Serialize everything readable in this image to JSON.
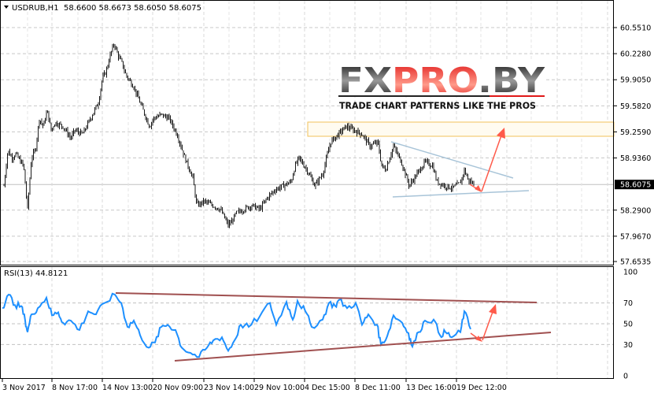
{
  "header": {
    "symbol": "USDRUB,H1",
    "ohlc": "58.6600 58.6673 58.6050 58.6075"
  },
  "rsi_header": "RSI(13) 44.8121",
  "logo": {
    "main": "FXPRO.BY",
    "tagline": "TRADE CHART PATTERNS LIKE THE PROS"
  },
  "colors": {
    "bars": "#000000",
    "rsi": "#1e90ff",
    "trend_rsi": "#a05050",
    "trend_main": "#a8c4d8",
    "arrow": "#ff5a4a",
    "zone": "#f2c25a"
  },
  "chart_data": [
    {
      "type": "ohlc",
      "title": "USDRUB,H1",
      "ylim": [
        57.6535,
        60.551
      ],
      "yticks": [
        "60.5510",
        "60.2280",
        "59.9050",
        "59.5820",
        "59.2590",
        "58.9360",
        "58.2900",
        "57.9670",
        "57.6535"
      ],
      "current_price": "58.6075",
      "xticks": [
        "3 Nov 2017",
        "8 Nov 17:00",
        "14 Nov 13:00",
        "20 Nov 09:00",
        "23 Nov 14:00",
        "29 Nov 10:00",
        "4 Dec 15:00",
        "8 Dec 11:00",
        "13 Dec 16:00",
        "19 Dec 12:00"
      ],
      "close_path": [
        [
          5,
          58.593
        ],
        [
          10,
          59.034
        ],
        [
          15,
          58.936
        ],
        [
          20,
          58.985
        ],
        [
          30,
          58.838
        ],
        [
          35,
          58.3
        ],
        [
          40,
          58.936
        ],
        [
          45,
          59.034
        ],
        [
          50,
          59.425
        ],
        [
          55,
          59.327
        ],
        [
          60,
          59.523
        ],
        [
          65,
          59.279
        ],
        [
          70,
          59.376
        ],
        [
          80,
          59.327
        ],
        [
          90,
          59.181
        ],
        [
          95,
          59.279
        ],
        [
          105,
          59.23
        ],
        [
          115,
          59.425
        ],
        [
          120,
          59.523
        ],
        [
          125,
          59.621
        ],
        [
          130,
          59.915
        ],
        [
          135,
          60.013
        ],
        [
          140,
          60.208
        ],
        [
          145,
          60.355
        ],
        [
          150,
          60.208
        ],
        [
          155,
          60.111
        ],
        [
          160,
          59.964
        ],
        [
          170,
          59.817
        ],
        [
          180,
          59.572
        ],
        [
          190,
          59.327
        ],
        [
          195,
          59.425
        ],
        [
          205,
          59.474
        ],
        [
          215,
          59.425
        ],
        [
          225,
          59.23
        ],
        [
          235,
          58.936
        ],
        [
          245,
          58.691
        ],
        [
          250,
          58.349
        ],
        [
          260,
          58.398
        ],
        [
          270,
          58.349
        ],
        [
          280,
          58.3
        ],
        [
          290,
          58.104
        ],
        [
          295,
          58.153
        ],
        [
          300,
          58.251
        ],
        [
          310,
          58.3
        ],
        [
          320,
          58.349
        ],
        [
          330,
          58.3
        ],
        [
          340,
          58.447
        ],
        [
          350,
          58.545
        ],
        [
          360,
          58.593
        ],
        [
          370,
          58.642
        ],
        [
          375,
          58.838
        ],
        [
          380,
          58.936
        ],
        [
          390,
          58.789
        ],
        [
          400,
          58.593
        ],
        [
          410,
          58.74
        ],
        [
          420,
          59.132
        ],
        [
          430,
          59.23
        ],
        [
          440,
          59.327
        ],
        [
          450,
          59.279
        ],
        [
          460,
          59.23
        ],
        [
          470,
          59.083
        ],
        [
          480,
          59.132
        ],
        [
          485,
          58.838
        ],
        [
          490,
          58.789
        ],
        [
          500,
          59.083
        ],
        [
          510,
          58.887
        ],
        [
          520,
          58.593
        ],
        [
          530,
          58.74
        ],
        [
          540,
          58.887
        ],
        [
          550,
          58.838
        ],
        [
          555,
          58.642
        ],
        [
          565,
          58.593
        ],
        [
          575,
          58.564
        ],
        [
          585,
          58.623
        ],
        [
          590,
          58.789
        ],
        [
          595,
          58.662
        ],
        [
          603,
          58.6075
        ]
      ]
    },
    {
      "type": "line",
      "title": "RSI(13) 44.8121",
      "ylim": [
        0,
        100
      ],
      "yticks": [
        "100",
        "70",
        "50",
        "30",
        "0"
      ],
      "series": [
        {
          "name": "RSI(13)",
          "points": [
            [
              3,
              65
            ],
            [
              11,
              78
            ],
            [
              19,
              68
            ],
            [
              27,
              67
            ],
            [
              32,
              53
            ],
            [
              35,
              42
            ],
            [
              40,
              59
            ],
            [
              48,
              65
            ],
            [
              59,
              75
            ],
            [
              66,
              58
            ],
            [
              74,
              61
            ],
            [
              80,
              51
            ],
            [
              90,
              53
            ],
            [
              101,
              44
            ],
            [
              112,
              62
            ],
            [
              122,
              59
            ],
            [
              133,
              70
            ],
            [
              146,
              78
            ],
            [
              154,
              70
            ],
            [
              162,
              47
            ],
            [
              170,
              53
            ],
            [
              178,
              39
            ],
            [
              189,
              27
            ],
            [
              197,
              32
            ],
            [
              205,
              47
            ],
            [
              213,
              49
            ],
            [
              223,
              44
            ],
            [
              231,
              27
            ],
            [
              242,
              22
            ],
            [
              253,
              18
            ],
            [
              263,
              27
            ],
            [
              271,
              34
            ],
            [
              282,
              37
            ],
            [
              290,
              24
            ],
            [
              298,
              34
            ],
            [
              306,
              49
            ],
            [
              316,
              47
            ],
            [
              330,
              57
            ],
            [
              343,
              70
            ],
            [
              351,
              49
            ],
            [
              364,
              71
            ],
            [
              372,
              54
            ],
            [
              378,
              72
            ],
            [
              388,
              62
            ],
            [
              396,
              47
            ],
            [
              410,
              54
            ],
            [
              418,
              70
            ],
            [
              426,
              67
            ],
            [
              431,
              73
            ],
            [
              441,
              65
            ],
            [
              452,
              70
            ],
            [
              460,
              49
            ],
            [
              468,
              59
            ],
            [
              479,
              49
            ],
            [
              484,
              30
            ],
            [
              492,
              38
            ],
            [
              500,
              58
            ],
            [
              511,
              51
            ],
            [
              519,
              41
            ],
            [
              524,
              28
            ],
            [
              532,
              42
            ],
            [
              540,
              53
            ],
            [
              551,
              54
            ],
            [
              559,
              39
            ],
            [
              566,
              42
            ],
            [
              574,
              37
            ],
            [
              585,
              42
            ],
            [
              590,
              62
            ],
            [
              598,
              44.8
            ]
          ]
        }
      ]
    }
  ]
}
